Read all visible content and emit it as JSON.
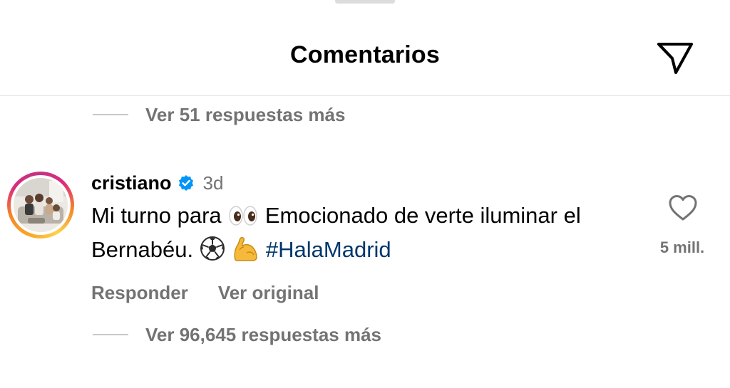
{
  "header": {
    "title": "Comentarios",
    "share_icon": "paper-plane-icon"
  },
  "replies_top": {
    "label": "Ver 51 respuestas más"
  },
  "comment": {
    "username": "cristiano",
    "verified_icon": "verified-badge-icon",
    "time": "3d",
    "text_part1": "Mi turno para ",
    "eyes_emoji": "👀",
    "text_part2": " Emocionado de verte iluminar el Bernabéu. ",
    "ball_emoji": "⚽",
    "muscle_emoji": "💪",
    "hashtag": "#HalaMadrid",
    "reply_label": "Responder",
    "original_label": "Ver original",
    "like_icon": "heart-outline-icon",
    "likes": "5 mill."
  },
  "replies_bottom": {
    "label": "Ver 96,645 respuestas más"
  },
  "colors": {
    "secondary_text": "#737373",
    "hashtag": "#00376b",
    "verified": "#0095f6"
  }
}
